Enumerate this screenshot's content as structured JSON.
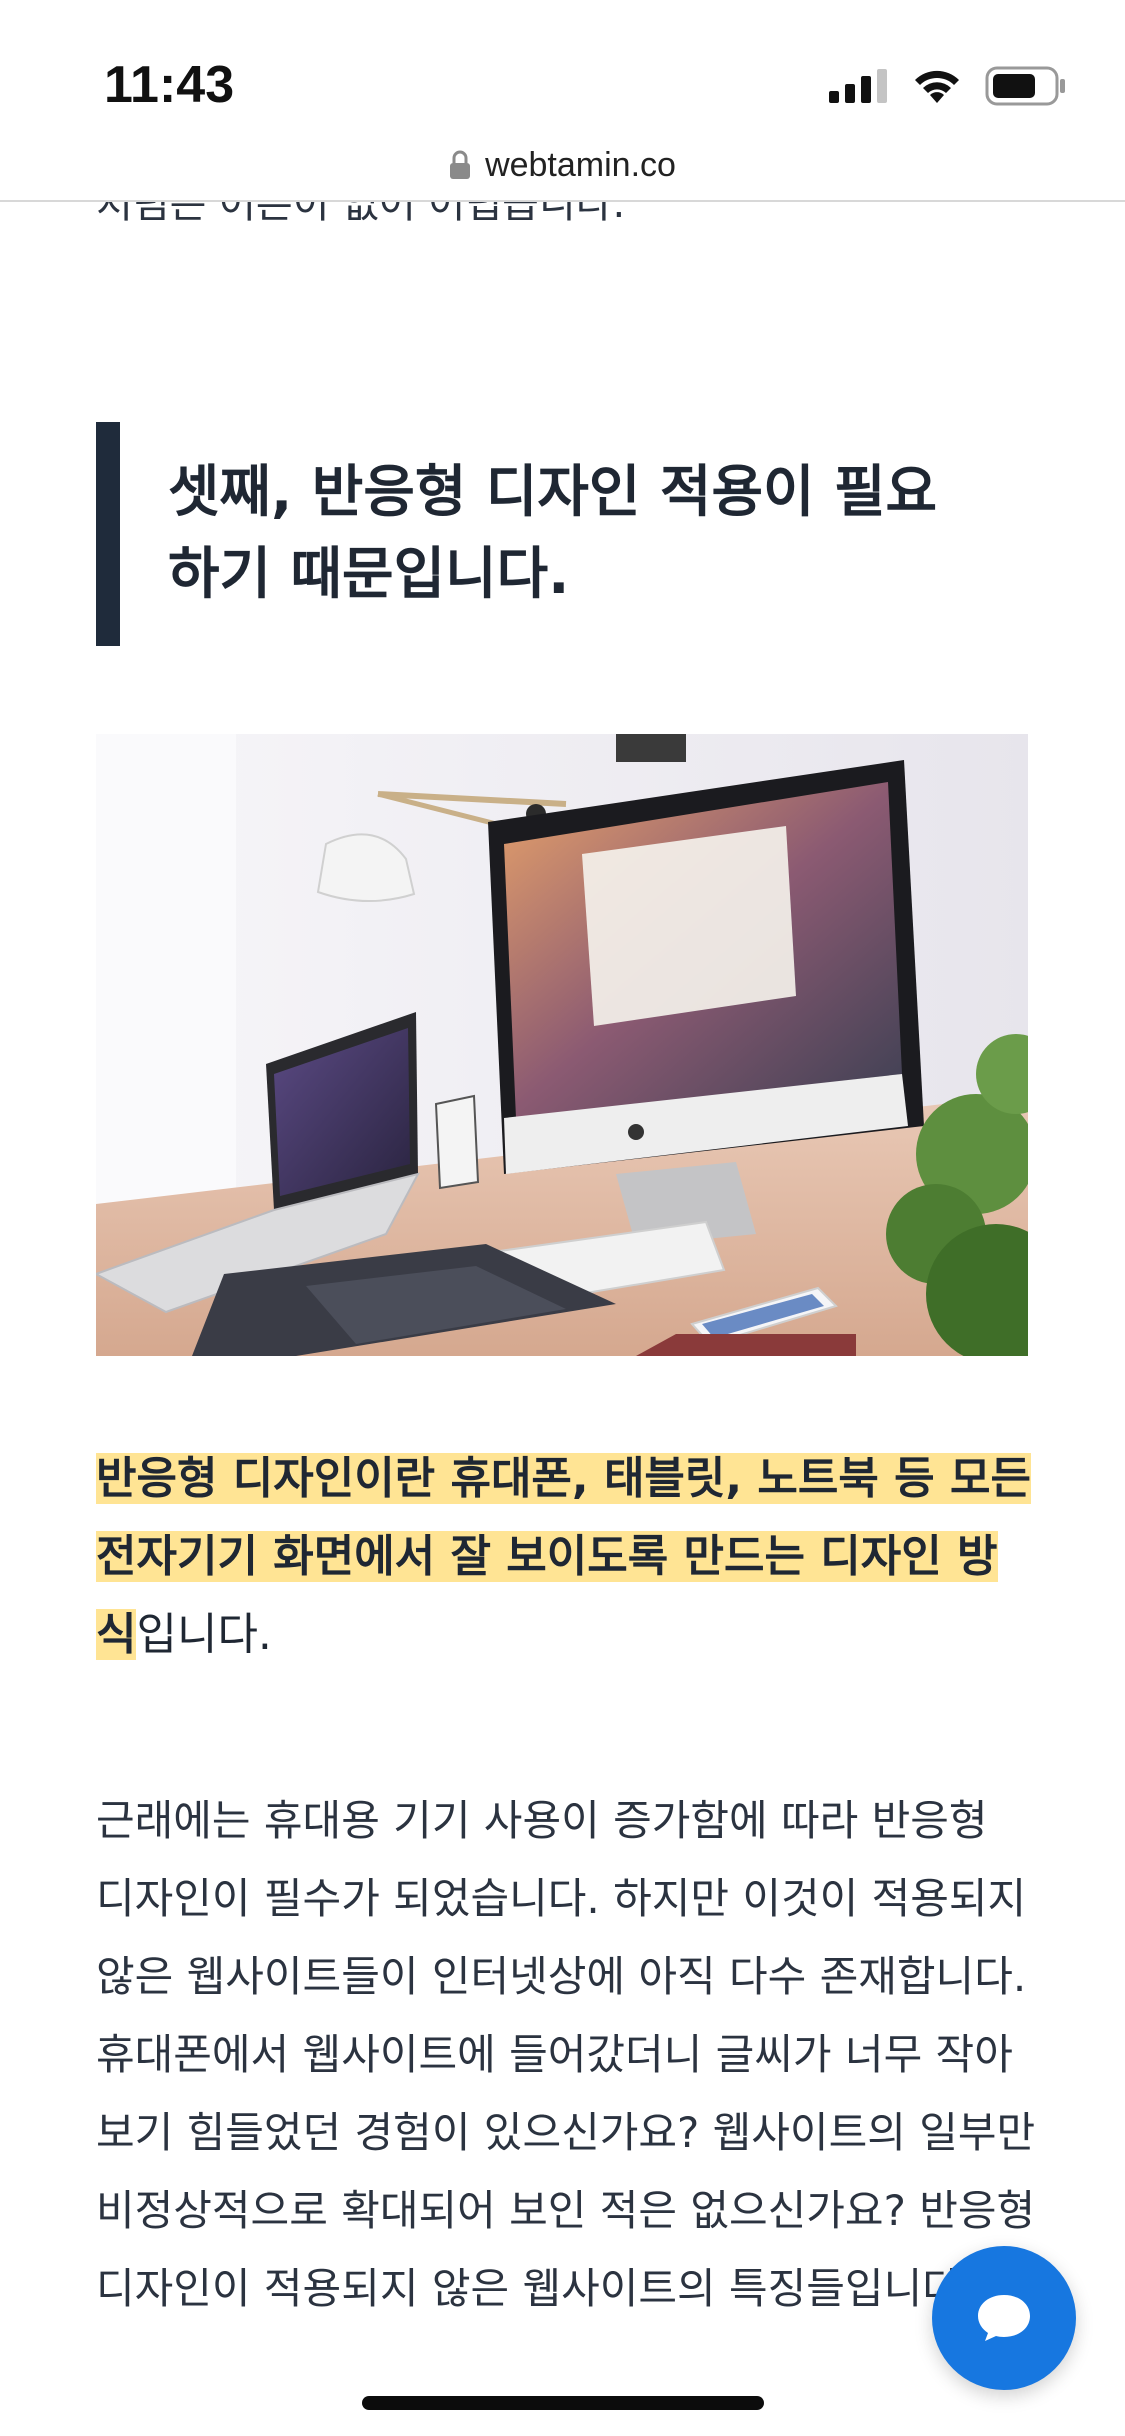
{
  "status_bar": {
    "time": "11:43",
    "icons": [
      "signal-icon",
      "wifi-icon",
      "battery-icon"
    ]
  },
  "browser": {
    "url": "webtamin.co",
    "lock_icon": "lock-icon"
  },
  "article": {
    "cut_off_text": "처럼은 어른이 없어 어렵습니다.",
    "heading": "셋째, 반응형 디자인 적용이 필요하기 때문입니다.",
    "image_alt": "desk-with-imac-laptop-tablet",
    "highlight_bold": "반응형 디자인이란 휴대폰, 태블릿, 노트북 등 모든 전자기기 화면에서 잘 보이도록 만드는 디자인 방식",
    "highlight_tail": "입니다.",
    "body": "근래에는 휴대용 기기 사용이 증가함에 따라 반응형 디자인이 필수가 되었습니다. 하지만 이것이 적용되지 않은 웹사이트들이 인터넷상에 아직 다수 존재합니다. 휴대폰에서 웹사이트에 들어갔더니 글씨가 너무 작아 보기 힘들었던 경험이 있으신가요? 웹사이트의 일부만 비정상적으로 확대되어 보인 적은 없으신가요? 반응형 디자인이 적용되지 않은 웹사이트의 특징들입니다."
  },
  "chat": {
    "icon": "chat-bubble-icon"
  },
  "colors": {
    "accent": "#1777e0",
    "highlight": "#ffe494",
    "quote_bar": "#1f2b3b"
  }
}
